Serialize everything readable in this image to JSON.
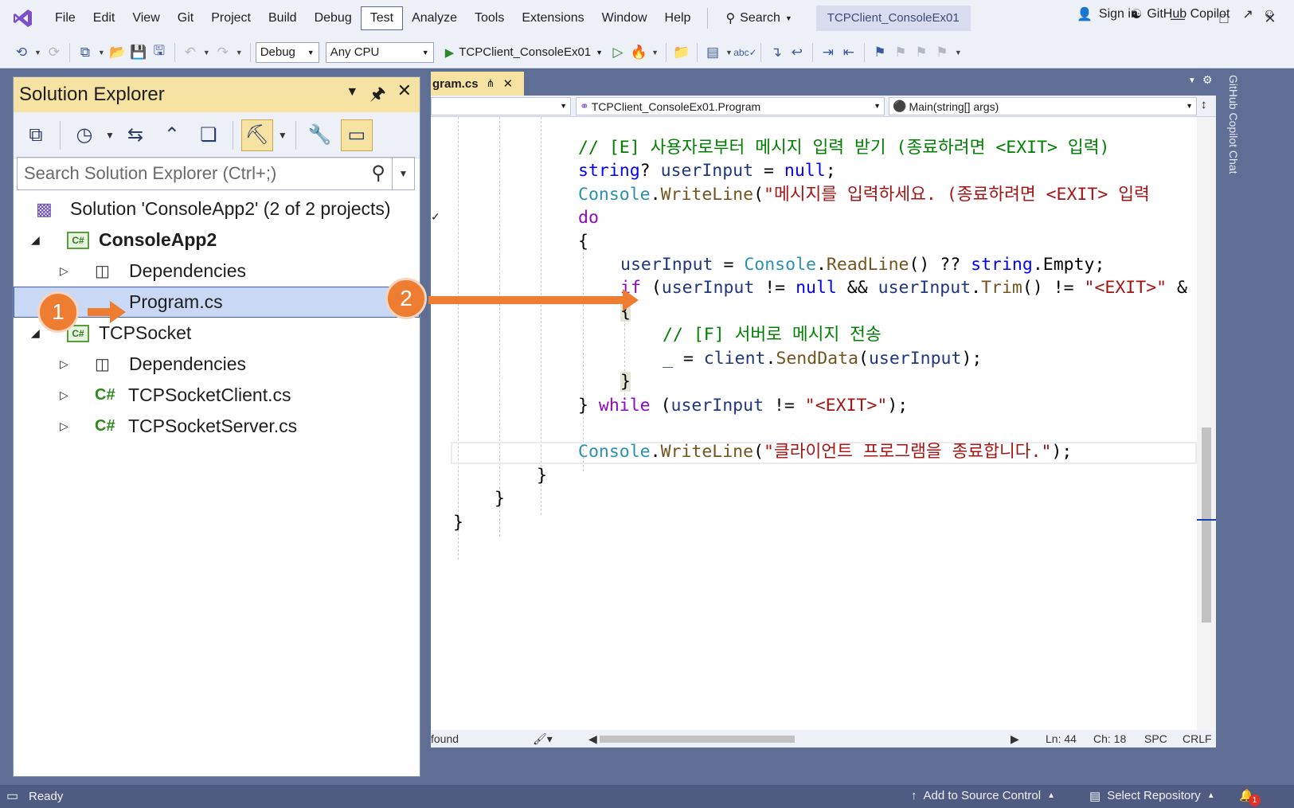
{
  "menu": {
    "items": [
      "File",
      "Edit",
      "View",
      "Git",
      "Project",
      "Build",
      "Debug",
      "Test",
      "Analyze",
      "Tools",
      "Extensions",
      "Window",
      "Help"
    ],
    "active": "Test",
    "search_label": "Search",
    "solution_title": "TCPClient_ConsoleEx01",
    "sign_in": "Sign in"
  },
  "toolbar": {
    "configuration": "Debug",
    "platform": "Any CPU",
    "run_target": "TCPClient_ConsoleEx01",
    "copilot_label": "GitHub Copilot"
  },
  "solution_explorer": {
    "title": "Solution Explorer",
    "search_placeholder": "Search Solution Explorer (Ctrl+;)",
    "tree": [
      {
        "label": "Solution 'ConsoleApp2' (2 of 2 projects)",
        "kind": "solution"
      },
      {
        "label": "ConsoleApp2",
        "kind": "project"
      },
      {
        "label": "Dependencies",
        "kind": "dependencies"
      },
      {
        "label": "Program.cs",
        "kind": "file",
        "selected": true
      },
      {
        "label": "TCPSocket",
        "kind": "project"
      },
      {
        "label": "Dependencies",
        "kind": "dependencies"
      },
      {
        "label": "TCPSocketClient.cs",
        "kind": "file"
      },
      {
        "label": "TCPSocketServer.cs",
        "kind": "file"
      }
    ]
  },
  "callouts": {
    "one": "1",
    "two": "2"
  },
  "editor": {
    "tab_label": "gram.cs",
    "nav_class": "TCPClient_ConsoleEx01.Program",
    "nav_member": "Main(string[] args)",
    "status": {
      "left": "found",
      "ln": "Ln: 44",
      "ch": "Ch: 18",
      "spc": "SPC",
      "eol": "CRLF"
    }
  },
  "code": {
    "l1": "// [E] 사용자로부터 메시지 입력 받기 (종료하려면 <EXIT> 입력)",
    "l2_kw": "string",
    "l2_rest": "? ",
    "l2_var": "userInput",
    "l2_eq": " = ",
    "l2_null": "null",
    "l2_end": ";",
    "l3_type": "Console",
    "l3_dot": ".",
    "l3_m": "WriteLine",
    "l3_p": "(",
    "l3_s": "\"메시지를 입력하세요. (종료하려면 <EXIT> 입력",
    "l4": "do",
    "l5": "{",
    "l6_v": "userInput",
    "l6_eq": " = ",
    "l6_t": "Console",
    "l6_dot": ".",
    "l6_m": "ReadLine",
    "l6_mid": "() ?? ",
    "l6_k": "string",
    "l6_end": ".Empty;",
    "l7_if": "if",
    "l7_a": " (",
    "l7_v1": "userInput",
    "l7_b": " != ",
    "l7_null": "null",
    "l7_c": " && ",
    "l7_v2": "userInput",
    "l7_d": ".",
    "l7_m": "Trim",
    "l7_e": "() != ",
    "l7_s": "\"<EXIT>\"",
    "l7_f": " &",
    "l8": "{",
    "l9": "// [F] 서버로 메시지 전송",
    "l10_u": "_",
    "l10_eq": " = ",
    "l10_v": "client",
    "l10_dot": ".",
    "l10_m": "SendData",
    "l10_p": "(",
    "l10_v2": "userInput",
    "l10_end": ");",
    "l11": "}",
    "l12_a": "} ",
    "l12_w": "while",
    "l12_b": " (",
    "l12_v": "userInput",
    "l12_c": " != ",
    "l12_s": "\"<EXIT>\"",
    "l12_end": ");",
    "l13_t": "Console",
    "l13_dot": ".",
    "l13_m": "WriteLine",
    "l13_p": "(",
    "l13_s": "\"클라이언트 프로그램을 종료합니다.\"",
    "l13_end": ");",
    "l14": "}",
    "l15": "}",
    "l16": "}"
  },
  "statusbar": {
    "ready": "Ready",
    "source_control": "Add to Source Control",
    "repository": "Select Repository",
    "notifications": "1"
  },
  "rail": {
    "label": "GitHub Copilot Chat"
  },
  "colors": {
    "accent_orange": "#ee7d31",
    "header_yellow": "#f6e2a2",
    "frame": "#5e6e94"
  }
}
